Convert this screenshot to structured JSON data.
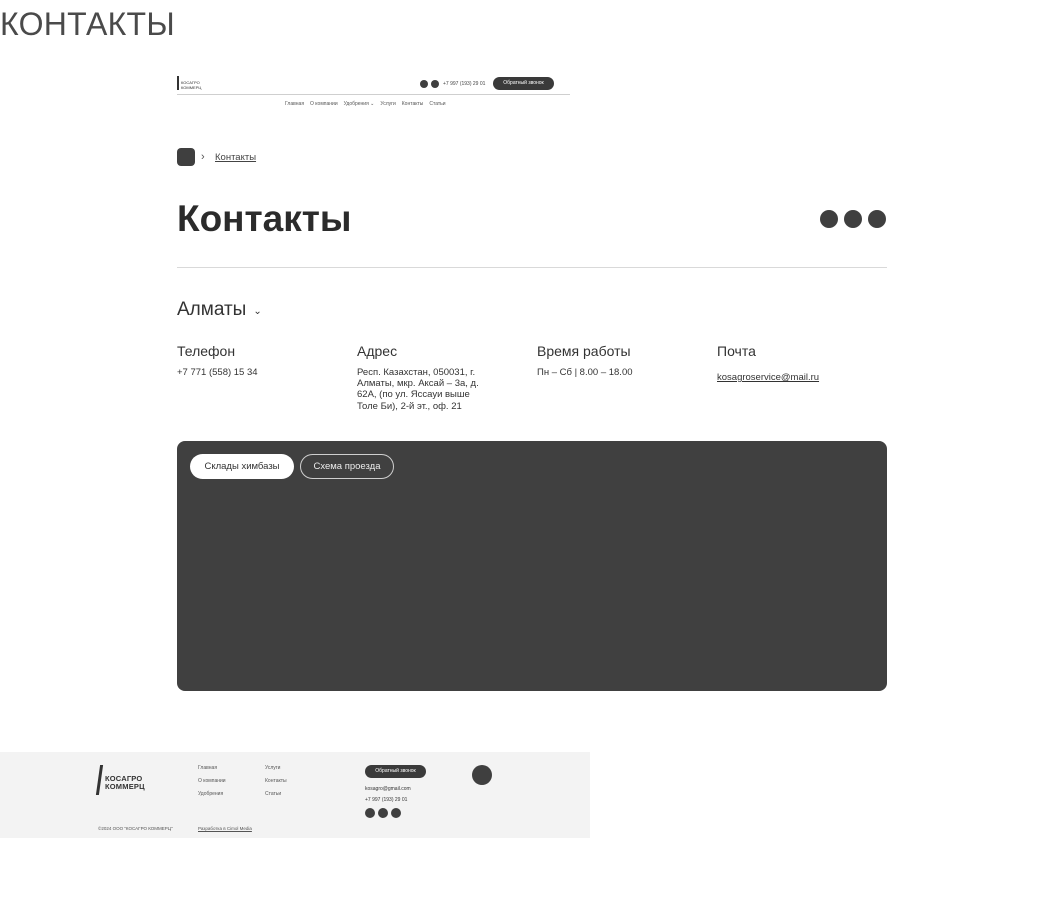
{
  "page_label": "КОНТАКТЫ",
  "mini_header": {
    "logo_line1": "КОСАГРО",
    "logo_line2": "КОММЕРЦ",
    "phone": "+7 997 (193) 29 01",
    "cta": "Обратный звонок",
    "nav": [
      "Главная",
      "О компании",
      "Удобрения ⌄",
      "Услуги",
      "Контакты",
      "Статьи"
    ]
  },
  "breadcrumb": {
    "chevron": "›",
    "current": "Контакты"
  },
  "title": "Контакты",
  "city": {
    "label": "Алматы",
    "chevron": "⌄"
  },
  "contacts": {
    "phone": {
      "label": "Телефон",
      "value": "+7 771 (558) 15 34"
    },
    "address": {
      "label": "Адрес",
      "value": "Респ. Казахстан, 050031, г. Алматы, мкр. Аксай – 3а, д. 62А, (по ул. Яссауи выше Толе Би), 2-й эт., оф. 21"
    },
    "hours": {
      "label": "Время работы",
      "value": "Пн – Сб | 8.00 – 18.00"
    },
    "email": {
      "label": "Почта",
      "value": "kosagroservice@mail.ru"
    }
  },
  "map": {
    "tabs": [
      "Склады химбазы",
      "Схема проезда"
    ]
  },
  "footer": {
    "logo_line1": "КОСАГРО",
    "logo_line2": "КОММЕРЦ",
    "links_col1": [
      "Главная",
      "О компании",
      "Удобрения"
    ],
    "links_col2": [
      "Услуги",
      "Контакты",
      "Статьи"
    ],
    "cta": "Обратный звонок",
    "email": "kosagro@gmail.com",
    "phone": "+7 997 (193) 29 01",
    "copyright": "©2024 ООО \"КОСАГРО КОММЕРЦ\"",
    "developer": "Разработка в Cimol Media"
  },
  "colors": {
    "accent_dark": "#3f3f3f",
    "map_bg": "#404040",
    "footer_bg": "#f3f3f3"
  }
}
